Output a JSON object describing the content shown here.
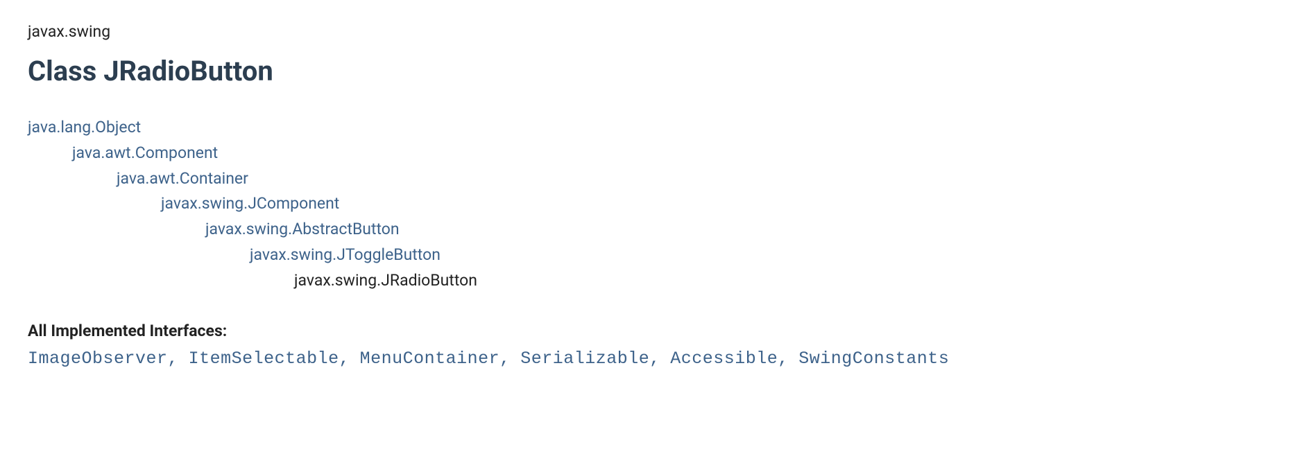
{
  "package_name": "javax.swing",
  "class_title": "Class JRadioButton",
  "inheritance": [
    {
      "name": "java.lang.Object",
      "link": true
    },
    {
      "name": "java.awt.Component",
      "link": true
    },
    {
      "name": "java.awt.Container",
      "link": true
    },
    {
      "name": "javax.swing.JComponent",
      "link": true
    },
    {
      "name": "javax.swing.AbstractButton",
      "link": true
    },
    {
      "name": "javax.swing.JToggleButton",
      "link": true
    },
    {
      "name": "javax.swing.JRadioButton",
      "link": false
    }
  ],
  "interfaces_label": "All Implemented Interfaces:",
  "interfaces": [
    "ImageObserver",
    "ItemSelectable",
    "MenuContainer",
    "Serializable",
    "Accessible",
    "SwingConstants"
  ]
}
